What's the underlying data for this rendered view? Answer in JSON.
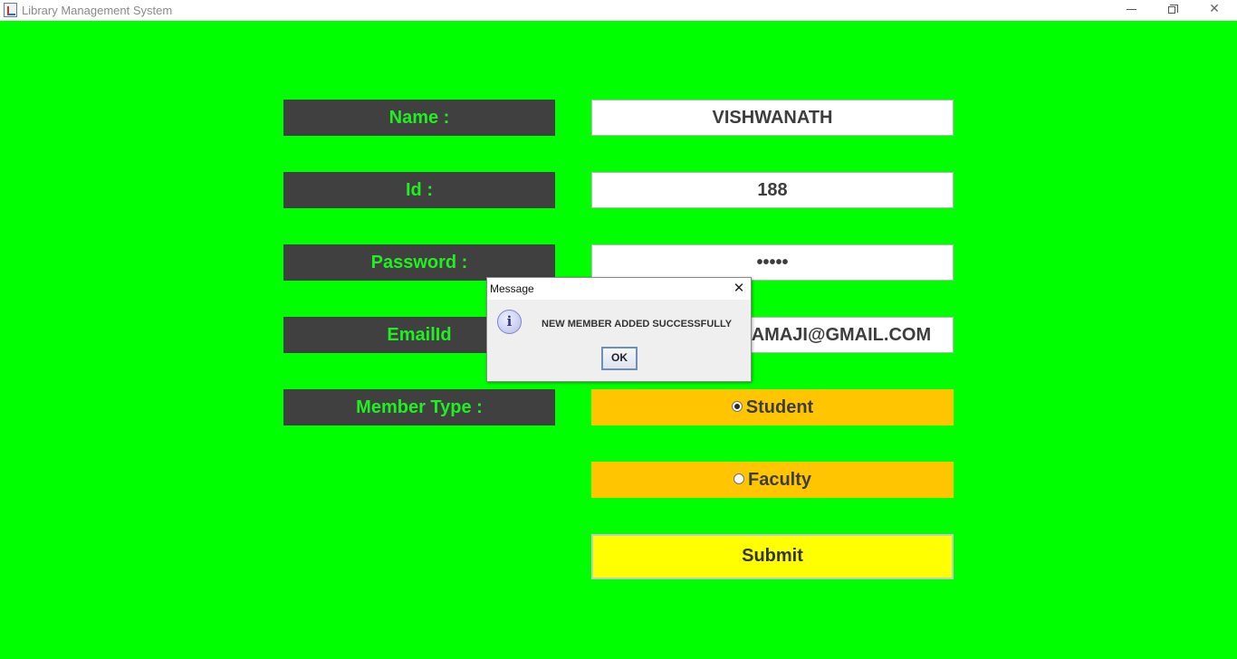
{
  "window": {
    "title": "Library Management System",
    "controls": {
      "minimize": "minimize-icon",
      "maximize": "maximize-icon",
      "close": "✕"
    }
  },
  "form": {
    "labels": {
      "name": "Name :",
      "id": "Id :",
      "password": "Password :",
      "email": "EmailId",
      "member_type": "Member Type :"
    },
    "values": {
      "name": "VISHWANATH",
      "id": "188",
      "password": "•••••",
      "email": "VISHWANATH.SAMAJI@GMAIL.COM"
    },
    "member_types": [
      {
        "label": "Student",
        "selected": true
      },
      {
        "label": "Faculty",
        "selected": false
      }
    ],
    "submit_label": "Submit"
  },
  "dialog": {
    "title": "Message",
    "close": "✕",
    "icon": "info-icon",
    "icon_glyph": "i",
    "message": "NEW MEMBER  ADDED SUCCESSFULLY",
    "ok_label": "OK"
  },
  "colors": {
    "background": "#00ff00",
    "label_bg": "#404040",
    "label_text": "#1ff01f",
    "radio_bg": "#ffc600",
    "submit_bg": "#ffff00"
  }
}
